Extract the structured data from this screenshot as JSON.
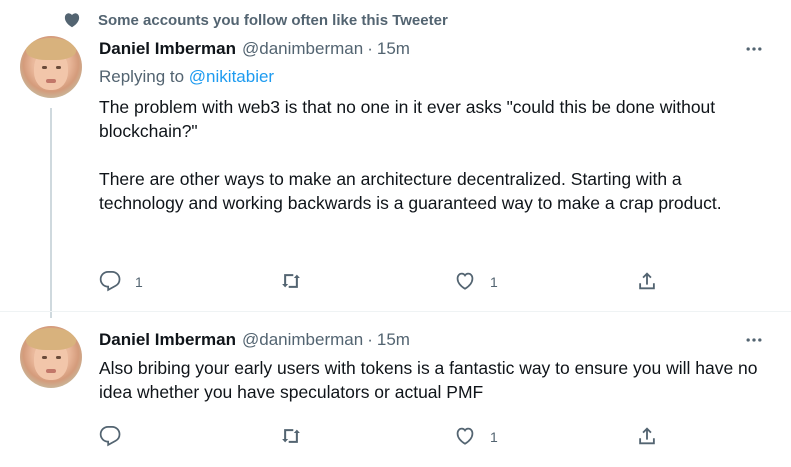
{
  "social_context": {
    "icon": "heart-icon",
    "text": "Some accounts you follow often like this Tweeter"
  },
  "tweets": [
    {
      "author_name": "Daniel Imberman",
      "handle": "@danimberman",
      "separator": "·",
      "time": "15m",
      "replying_to_label": "Replying to",
      "replying_to_handle": "@nikitabier",
      "body": [
        "The problem with web3 is that no one in it ever asks \"could this be done without blockchain?\"",
        "There are other ways to make an architecture decentralized. Starting with a technology and working backwards is a guaranteed way to make a crap product."
      ],
      "replies": "1",
      "retweets": "",
      "likes": "1"
    },
    {
      "author_name": "Daniel Imberman",
      "handle": "@danimberman",
      "separator": "·",
      "time": "15m",
      "body": [
        "Also bribing your early users with tokens is a fantastic way to ensure you will have no idea whether you have speculators or actual PMF"
      ],
      "replies": "",
      "retweets": "",
      "likes": "1"
    }
  ],
  "colors": {
    "text": "#0f1419",
    "secondary": "#536471",
    "accent": "#1d9bf0",
    "thread_line": "#cfd9de"
  }
}
